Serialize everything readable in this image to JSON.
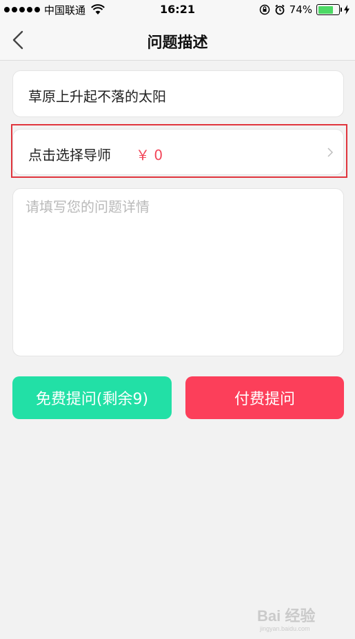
{
  "status_bar": {
    "carrier": "中国联通",
    "time": "16:21",
    "battery_percent": "74%",
    "battery_level": 0.74
  },
  "nav": {
    "title": "问题描述",
    "back_icon": "chevron-left-icon"
  },
  "question": {
    "title_value": "草原上升起不落的太阳"
  },
  "tutor": {
    "label": "点击选择导师",
    "price": "￥ 0",
    "chevron_icon": "chevron-right-icon"
  },
  "detail": {
    "placeholder": "请填写您的问题详情",
    "value": ""
  },
  "buttons": {
    "free_label": "免费提问(剩余9)",
    "paid_label": "付费提问"
  },
  "colors": {
    "free_button": "#22e0a6",
    "paid_button": "#fc3f5a",
    "price": "#f2475a",
    "highlight": "#e0343c",
    "battery": "#4cd964"
  },
  "watermark": {
    "text": "Bai 经验",
    "subtext": "jingyan.baidu.com"
  }
}
